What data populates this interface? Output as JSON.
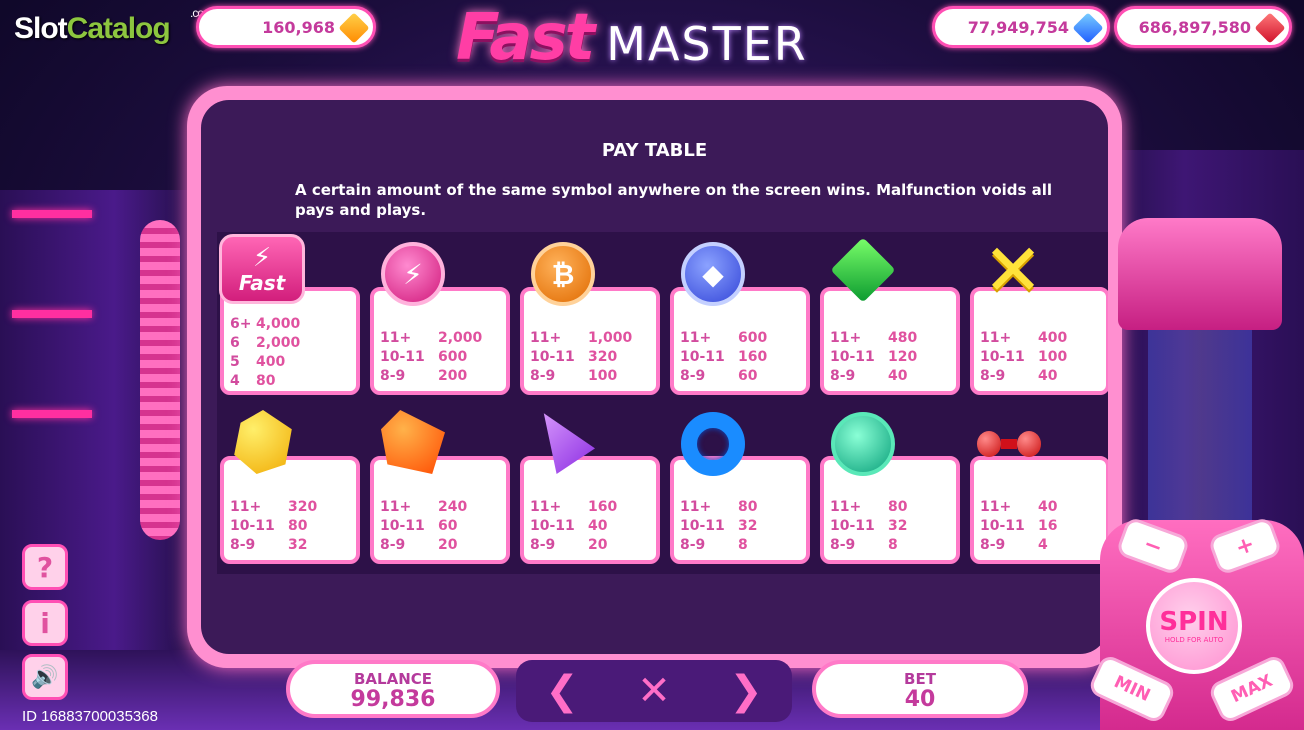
{
  "watermark": {
    "slot": "Slot",
    "catalog": "Catalog",
    "com": ".com"
  },
  "jackpots": [
    {
      "value": "160,968",
      "gem": "yellow-gem-icon"
    },
    {
      "value": "77,949,754",
      "gem": "blue-gem-icon"
    },
    {
      "value": "686,897,580",
      "gem": "red-gem-icon"
    }
  ],
  "title": {
    "fast": "Fast",
    "master": "MASTER"
  },
  "paytable": {
    "heading": "PAY TABLE",
    "description": "A certain amount of the same symbol anywhere on the screen wins. Malfunction voids all pays and plays.",
    "symbols": [
      {
        "icon": "fast-scatter-icon",
        "label": "Fast",
        "rows": [
          {
            "count": "6+",
            "pay": "4,000"
          },
          {
            "count": "6",
            "pay": "2,000"
          },
          {
            "count": "5",
            "pay": "400"
          },
          {
            "count": "4",
            "pay": "80"
          }
        ]
      },
      {
        "icon": "pink-lightning-coin-icon",
        "rows": [
          {
            "count": "11+",
            "pay": "2,000"
          },
          {
            "count": "10-11",
            "pay": "600"
          },
          {
            "count": "8-9",
            "pay": "200"
          }
        ]
      },
      {
        "icon": "bitcoin-coin-icon",
        "rows": [
          {
            "count": "11+",
            "pay": "1,000"
          },
          {
            "count": "10-11",
            "pay": "320"
          },
          {
            "count": "8-9",
            "pay": "100"
          }
        ]
      },
      {
        "icon": "ethereum-coin-icon",
        "rows": [
          {
            "count": "11+",
            "pay": "600"
          },
          {
            "count": "10-11",
            "pay": "160"
          },
          {
            "count": "8-9",
            "pay": "60"
          }
        ]
      },
      {
        "icon": "green-gem-icon",
        "rows": [
          {
            "count": "11+",
            "pay": "480"
          },
          {
            "count": "10-11",
            "pay": "120"
          },
          {
            "count": "8-9",
            "pay": "40"
          }
        ]
      },
      {
        "icon": "yellow-cross-icon",
        "rows": [
          {
            "count": "11+",
            "pay": "400"
          },
          {
            "count": "10-11",
            "pay": "100"
          },
          {
            "count": "8-9",
            "pay": "40"
          }
        ]
      },
      {
        "icon": "yellow-polyhedron-icon",
        "rows": [
          {
            "count": "11+",
            "pay": "320"
          },
          {
            "count": "10-11",
            "pay": "80"
          },
          {
            "count": "8-9",
            "pay": "32"
          }
        ]
      },
      {
        "icon": "orange-shape-icon",
        "rows": [
          {
            "count": "11+",
            "pay": "240"
          },
          {
            "count": "10-11",
            "pay": "60"
          },
          {
            "count": "8-9",
            "pay": "20"
          }
        ]
      },
      {
        "icon": "purple-cone-icon",
        "rows": [
          {
            "count": "11+",
            "pay": "160"
          },
          {
            "count": "10-11",
            "pay": "40"
          },
          {
            "count": "8-9",
            "pay": "20"
          }
        ]
      },
      {
        "icon": "blue-ring-icon",
        "rows": [
          {
            "count": "11+",
            "pay": "80"
          },
          {
            "count": "10-11",
            "pay": "32"
          },
          {
            "count": "8-9",
            "pay": "8"
          }
        ]
      },
      {
        "icon": "teal-gem-icon",
        "rows": [
          {
            "count": "11+",
            "pay": "80"
          },
          {
            "count": "10-11",
            "pay": "32"
          },
          {
            "count": "8-9",
            "pay": "8"
          }
        ]
      },
      {
        "icon": "red-dumbbell-icon",
        "rows": [
          {
            "count": "11+",
            "pay": "40"
          },
          {
            "count": "10-11",
            "pay": "16"
          },
          {
            "count": "8-9",
            "pay": "4"
          }
        ]
      }
    ]
  },
  "side_buttons": {
    "help": "?",
    "info": "i",
    "sound": "🔊"
  },
  "footer": {
    "id_text": "ID 1688370003536​8",
    "balance_label": "BALANCE",
    "balance_value": "99,836",
    "bet_label": "BET",
    "bet_value": "40",
    "prev": "❮",
    "close": "✕",
    "next": "❯"
  },
  "machine": {
    "minus": "−",
    "plus": "+",
    "spin": "SPIN",
    "spin_sub": "HOLD FOR AUTO",
    "min": "MIN",
    "max": "MAX"
  },
  "colors": {
    "accent": "#ff4fb4",
    "panel": "#3c1a58",
    "pay_text": "#e0529f"
  }
}
